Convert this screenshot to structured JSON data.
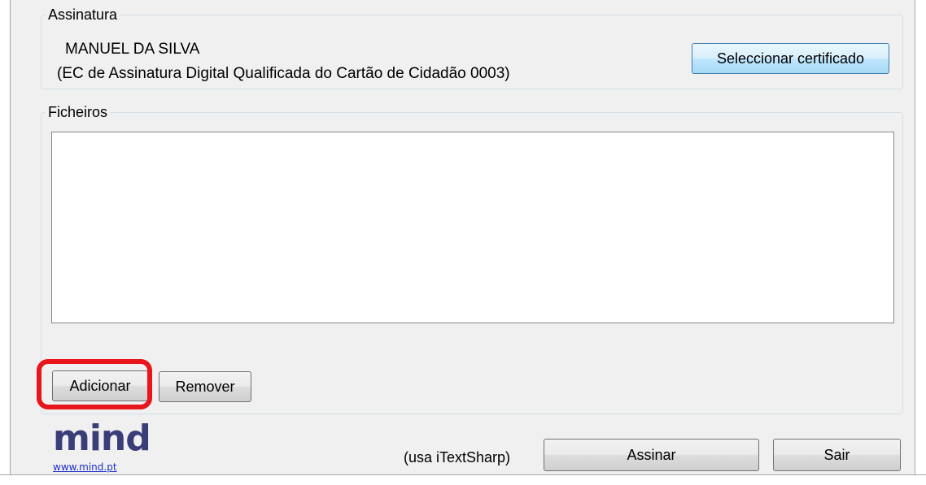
{
  "signature_group": {
    "title": "Assinatura",
    "cert_name": "MANUEL DA SILVA",
    "cert_issuer": "(EC de Assinatura Digital Qualificada do Cartão de Cidadão 0003)",
    "select_button": "Seleccionar certificado"
  },
  "files_group": {
    "title": "Ficheiros",
    "items": [],
    "add_button": "Adicionar",
    "remove_button": "Remover"
  },
  "footer": {
    "logo_text": "mind",
    "logo_link": "www.mind.pt",
    "note": "(usa iTextSharp)",
    "sign_button": "Assinar",
    "exit_button": "Sair"
  },
  "colors": {
    "highlight": "#e8151b",
    "logo": "#3a3e78",
    "link": "#1c2ec8"
  }
}
